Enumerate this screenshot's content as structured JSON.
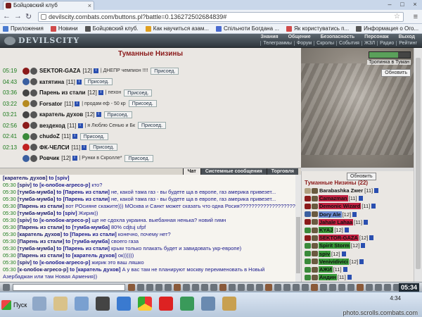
{
  "browser": {
    "tab_title": "Бойцовский клуб",
    "url": "devilscity.combats.com/buttons.pl?battle=0.136272502684839#"
  },
  "bookmarks": [
    {
      "label": "Приложения",
      "color": "#4a7bd0"
    },
    {
      "label": "Новини",
      "color": "#d04a4a"
    },
    {
      "label": "Бойцовский клуб.",
      "color": "#555"
    },
    {
      "label": "Как научиться азам...",
      "color": "#e0a020"
    },
    {
      "label": "Спільноти Богдана ...",
      "color": "#4a6bd0"
    },
    {
      "label": "Як користуватись п...",
      "color": "#d04a4a"
    },
    {
      "label": "Информация о Ого...",
      "color": "#555"
    }
  ],
  "game": {
    "logo": "DEVILSCITY",
    "nav1": [
      "Знания",
      "Общение",
      "Безопасность",
      "Персонаж",
      "Выход"
    ],
    "nav2": [
      "Телеграммы",
      "Форум",
      "Скролы",
      "События",
      "ЖЗЛ",
      "Радио",
      "Рейтинг"
    ]
  },
  "location": {
    "title": "Туманные Низины",
    "path_link": "Тропинка в Туман",
    "refresh": "Обновить",
    "trail_progress": 0.7,
    "players": [
      {
        "time": "05:19",
        "name": "SEKTOR-GAZA",
        "level": "[12]",
        "note": "| ДНЕПР чемпион !!!!",
        "btn": "Присоед.",
        "c": "#8b1a1a"
      },
      {
        "time": "04:43",
        "name": "катятина",
        "level": "[11]",
        "note": "",
        "btn": "Присоед.",
        "c": "#3a5fa0"
      },
      {
        "time": "03:36",
        "name": "Парень из стали",
        "level": "[12]",
        "note": "| пехон",
        "btn": "Присоед.",
        "c": "#444"
      },
      {
        "time": "03:22",
        "name": "Forsator",
        "level": "[11]",
        "note": "| продам еф - 50 кр",
        "btn": "Присоед.",
        "c": "#b58a20"
      },
      {
        "time": "03:21",
        "name": "каратель духов",
        "level": "[12]",
        "note": "",
        "btn": "Присоед.",
        "c": "#444"
      },
      {
        "time": "02:56",
        "name": "вездеход",
        "level": "[11]",
        "note": "| я Люблю Сенью и Бк",
        "btn": "Присоед.",
        "c": "#8b1a1a"
      },
      {
        "time": "02:41",
        "name": "chudoZ",
        "level": "[11]",
        "note": "",
        "btn": "Присоед.",
        "c": "#3a8a3a"
      },
      {
        "time": "02:13",
        "name": "ФК-ЧЕЛСИ",
        "level": "[11]",
        "note": "",
        "btn": "Присоед.",
        "c": "#c02020"
      },
      {
        "time": "",
        "name": "Ровчик",
        "level": "[12]",
        "note": "| Рунки в Скролле*",
        "btn": "Присоед.",
        "c": "#3a5fa0"
      }
    ]
  },
  "chat_tabs": [
    "Чат",
    "Системные сообщения",
    "Торговля"
  ],
  "chat": [
    {
      "time": "",
      "from": "[каратель духов]",
      "to": "to [spiv]",
      "text": ""
    },
    {
      "time": "05:30",
      "from": "[spiv]",
      "to": "to [к-олобок-агресо-р]",
      "text": "кто?"
    },
    {
      "time": "05:30",
      "from": "[тумба-мумба]",
      "to": "to [Парень из стали]",
      "text": "не, какой тама газ - вы будете ща в европе, газ америка привезет..."
    },
    {
      "time": "05:30",
      "from": "[тумба-мумба]",
      "to": "to [Парень из стали]",
      "text": "не, какой тама газ - вы будете ща в европе, газ америка привезет..."
    },
    {
      "time": "05:30",
      "from": "[Парень из стали]",
      "to": "",
      "text": "вот РОсияне скажите))) МОсква и Санкт может сказать что одна Росия???????????????????"
    },
    {
      "time": "05:30",
      "from": "[тумба-мумба]",
      "to": "to [spiv]",
      "text": "Жирик))"
    },
    {
      "time": "05:30",
      "from": "[spiv]",
      "to": "to [к-олобок-агресо-р]",
      "text": "ще не сдохла украина. выебанная ненька? новий гимн"
    },
    {
      "time": "05:30",
      "from": "[Парень из стали]",
      "to": "to [тумба-мумба]",
      "text": "80% cdjtuj ufpf"
    },
    {
      "time": "05:30",
      "from": "[каратель духов]",
      "to": "to [Парень из стали]",
      "text": "конечно, почему нет?"
    },
    {
      "time": "05:30",
      "from": "[Парень из стали]",
      "to": "to [тумба-мумба]",
      "text": "своего газа"
    },
    {
      "time": "05:30",
      "from": "[тумба-мумба]",
      "to": "to [Парень из стали]",
      "text": "крым только плакать будет и завидовать укр-европе)"
    },
    {
      "time": "05:30",
      "from": "[Парень из стали]",
      "to": "to [каратель духов]",
      "text": "ок))))))"
    },
    {
      "time": "05:30",
      "from": "[spiv]",
      "to": "to [к-олобок-агресо-р]",
      "text": "жирик это ваш ляшко"
    },
    {
      "time": "05:30",
      "from": "[к-олобок-агресо-р]",
      "to": "to [каратель духов]",
      "text": "А у вас там не планируют москву переименовать в Новый Азербаджан или там Новая Армения))"
    }
  ],
  "who": {
    "refresh": "Обновить",
    "title": "Туманные Низины (22)",
    "players": [
      {
        "name": "Barabashka Zwer",
        "level": "[11]",
        "hl": "",
        "c": "#b0a080"
      },
      {
        "name": "Camazman",
        "level": "[11]",
        "hl": "#c02040",
        "c": "#8b1a1a"
      },
      {
        "name": "Demonic Wizard",
        "level": "[11]",
        "hl": "#c02040",
        "c": "#8b1a1a"
      },
      {
        "name": "Dory Ale",
        "level": "[12]",
        "hl": "#6a8ad0",
        "c": "#3a5fa0"
      },
      {
        "name": "Jahale Lahaa",
        "level": "[11]",
        "hl": "#c02040",
        "c": "#8b1a1a"
      },
      {
        "name": "KYAJ",
        "level": "[12]",
        "hl": "#3a9a3a",
        "c": "#3a8a3a"
      },
      {
        "name": "SEKTOR-GAZA",
        "level": "[12]",
        "hl": "#c02040",
        "c": "#8b1a1a"
      },
      {
        "name": "Spirit Storm",
        "level": "[12]",
        "hl": "#3a9a3a",
        "c": "#3a8a3a"
      },
      {
        "name": "spiv",
        "level": "[12]",
        "hl": "#3a9a3a",
        "c": "#3a8a3a"
      },
      {
        "name": "Venividivici",
        "level": "[12]",
        "hl": "#3a9a3a",
        "c": "#3a8a3a"
      },
      {
        "name": "АЖИ",
        "level": "[11]",
        "hl": "#3a9a3a",
        "c": "#3a8a3a"
      },
      {
        "name": "Андин",
        "level": "[11]",
        "hl": "#3a9a3a",
        "c": "#3a8a3a"
      }
    ]
  },
  "clock": "05:34",
  "taskbar": {
    "start": "Пуск",
    "time": "4:34"
  },
  "watermark": "photo.scrolls.combats.com"
}
